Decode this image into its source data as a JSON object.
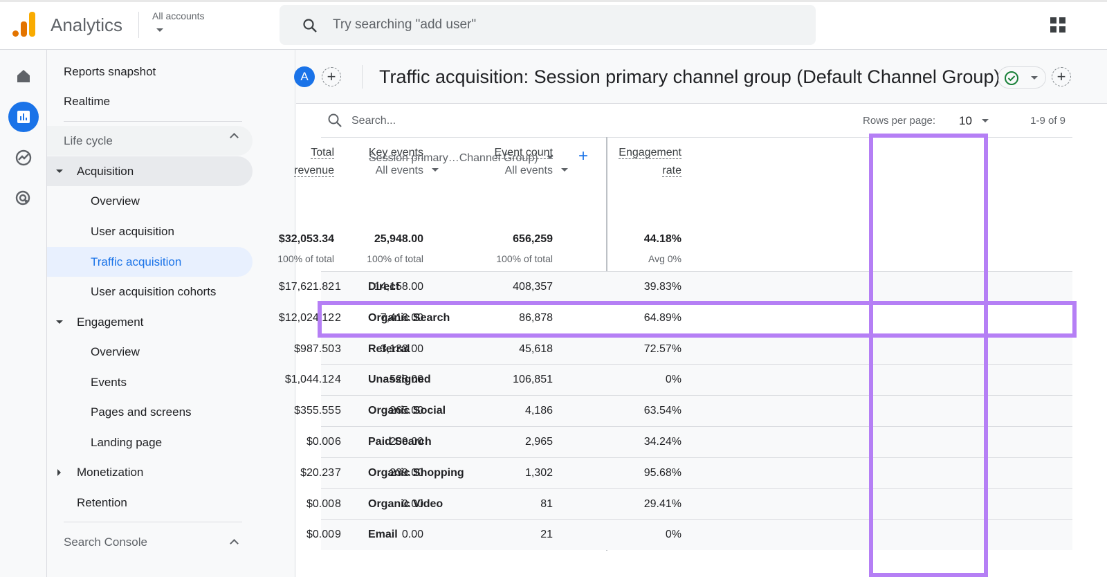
{
  "topbar": {
    "app_name": "Analytics",
    "account_label": "All accounts",
    "search_placeholder": "Try searching \"add user\""
  },
  "rail": [
    "home-icon",
    "reports-icon",
    "explore-icon",
    "advertising-icon"
  ],
  "sidebar": {
    "items": [
      {
        "label": "Reports snapshot"
      },
      {
        "label": "Realtime"
      },
      {
        "label": "Life cycle"
      },
      {
        "label": "Acquisition"
      },
      {
        "label": "Overview"
      },
      {
        "label": "User acquisition"
      },
      {
        "label": "Traffic acquisition"
      },
      {
        "label": "User acquisition cohorts"
      },
      {
        "label": "Engagement"
      },
      {
        "label": "Overview"
      },
      {
        "label": "Events"
      },
      {
        "label": "Pages and screens"
      },
      {
        "label": "Landing page"
      },
      {
        "label": "Monetization"
      },
      {
        "label": "Retention"
      },
      {
        "label": "Search Console"
      }
    ]
  },
  "report": {
    "avatar": "A",
    "title": "Traffic acquisition: Session primary channel group (Default Channel Group)"
  },
  "table": {
    "search_placeholder": "Search...",
    "rows_per_page_label": "Rows per page:",
    "rows_per_page": "10",
    "pagination": "1-9 of 9",
    "dimension_header": "Session primary…Channel Group)",
    "columns": [
      {
        "line1": "Engagement",
        "line2": "rate",
        "total": "44.18%",
        "sub": "Avg 0%"
      },
      {
        "line1": "Event count",
        "line2": "All events",
        "total": "656,259",
        "sub": "100% of total"
      },
      {
        "line1": "Key events",
        "line2": "All events",
        "total": "25,948.00",
        "sub": "100% of total"
      },
      {
        "line1": "Total",
        "line2": "revenue",
        "total": "$32,053.34",
        "sub": "100% of total"
      }
    ],
    "rows": [
      [
        "1",
        "Direct",
        "39.83%",
        "408,357",
        "14,158.00",
        "$17,621.82"
      ],
      [
        "2",
        "Organic Search",
        "64.89%",
        "86,878",
        "7,416.00",
        "$12,024.12"
      ],
      [
        "3",
        "Referral",
        "72.57%",
        "45,618",
        "3,133.00",
        "$987.50"
      ],
      [
        "4",
        "Unassigned",
        "0%",
        "106,851",
        "528.00",
        "$1,044.12"
      ],
      [
        "5",
        "Organic Social",
        "63.54%",
        "4,186",
        "265.00",
        "$355.55"
      ],
      [
        "6",
        "Paid Search",
        "34.24%",
        "2,965",
        "209.00",
        "$0.00"
      ],
      [
        "7",
        "Organic Shopping",
        "95.68%",
        "1,302",
        "239.00",
        "$20.23"
      ],
      [
        "8",
        "Organic Video",
        "29.41%",
        "81",
        "0.00",
        "$0.00"
      ],
      [
        "9",
        "Email",
        "0%",
        "21",
        "0.00",
        "$0.00"
      ]
    ]
  },
  "colors": {
    "accent": "#1a73e8",
    "highlight": "#b57ff5"
  }
}
